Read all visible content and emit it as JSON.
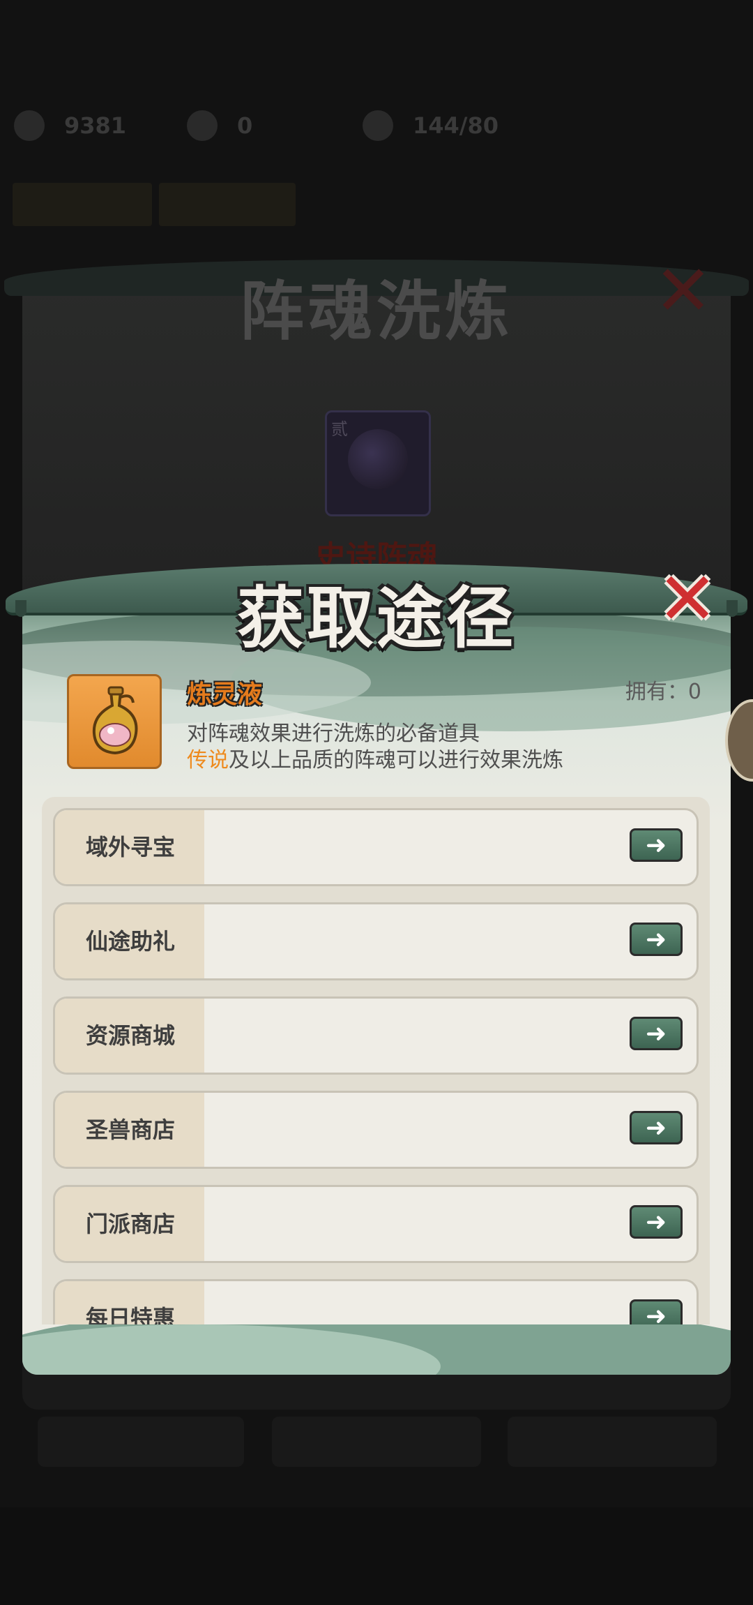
{
  "background": {
    "stats": [
      {
        "icon": "gem-icon",
        "value": "9381"
      },
      {
        "icon": "spirit-icon",
        "value": "0"
      },
      {
        "icon": "stamina-icon",
        "value": "144/80"
      }
    ],
    "panel_title": "阵魂洗炼",
    "item_tag": "贰",
    "item_grade": "史诗阵魂"
  },
  "dialog": {
    "title": "获取途径",
    "item": {
      "name": "炼灵液",
      "icon": "potion-flask-icon",
      "own_label": "拥有：0",
      "desc_line1": "对阵魂效果进行洗炼的必备道具",
      "desc_line2_highlight": "传说",
      "desc_line2_rest": "及以上品质的阵魂可以进行效果洗炼"
    },
    "sources": [
      {
        "label": "域外寻宝"
      },
      {
        "label": "仙途助礼"
      },
      {
        "label": "资源商城"
      },
      {
        "label": "圣兽商店"
      },
      {
        "label": "门派商店"
      },
      {
        "label": "每日特惠"
      }
    ]
  },
  "colors": {
    "title_text": "#f4f0e8",
    "close_red": "#cf2f31",
    "item_name_orange": "#e47b1d",
    "highlight_orange": "#ee8a1d",
    "go_button_green": "#4c7562"
  }
}
